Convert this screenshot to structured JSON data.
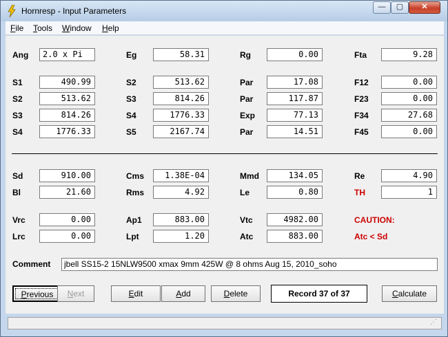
{
  "window": {
    "title": "Hornresp - Input Parameters",
    "controls": {
      "minimize": "—",
      "maximize": "▢",
      "close": "✕"
    },
    "accent_color": "#e8c400"
  },
  "menu": [
    {
      "label": "File",
      "accel": "F"
    },
    {
      "label": "Tools",
      "accel": "T"
    },
    {
      "label": "Window",
      "accel": "W"
    },
    {
      "label": "Help",
      "accel": "H"
    }
  ],
  "params": {
    "Ang": {
      "label": "Ang",
      "value": "2.0 x Pi"
    },
    "Eg": {
      "label": "Eg",
      "value": "58.31"
    },
    "Rg": {
      "label": "Rg",
      "value": "0.00"
    },
    "Fta": {
      "label": "Fta",
      "value": "9.28"
    },
    "S1": {
      "label": "S1",
      "value": "490.99"
    },
    "S2a": {
      "label": "S2",
      "value": "513.62"
    },
    "Par1": {
      "label": "Par",
      "value": "17.08"
    },
    "F12": {
      "label": "F12",
      "value": "0.00"
    },
    "S2b": {
      "label": "S2",
      "value": "513.62"
    },
    "S3a": {
      "label": "S3",
      "value": "814.26"
    },
    "Par2": {
      "label": "Par",
      "value": "117.87"
    },
    "F23": {
      "label": "F23",
      "value": "0.00"
    },
    "S3b": {
      "label": "S3",
      "value": "814.26"
    },
    "S4a": {
      "label": "S4",
      "value": "1776.33"
    },
    "Exp": {
      "label": "Exp",
      "value": "77.13"
    },
    "F34": {
      "label": "F34",
      "value": "27.68"
    },
    "S4b": {
      "label": "S4",
      "value": "1776.33"
    },
    "S5": {
      "label": "S5",
      "value": "2167.74"
    },
    "Par3": {
      "label": "Par",
      "value": "14.51"
    },
    "F45": {
      "label": "F45",
      "value": "0.00"
    },
    "Sd": {
      "label": "Sd",
      "value": "910.00"
    },
    "Cms": {
      "label": "Cms",
      "value": "1.38E-04"
    },
    "Mmd": {
      "label": "Mmd",
      "value": "134.05"
    },
    "Re": {
      "label": "Re",
      "value": "4.90"
    },
    "Bl": {
      "label": "Bl",
      "value": "21.60"
    },
    "Rms": {
      "label": "Rms",
      "value": "4.92"
    },
    "Le": {
      "label": "Le",
      "value": "0.80"
    },
    "TH": {
      "label": "TH",
      "value": "1"
    },
    "Vrc": {
      "label": "Vrc",
      "value": "0.00"
    },
    "Ap1": {
      "label": "Ap1",
      "value": "883.00"
    },
    "Vtc": {
      "label": "Vtc",
      "value": "4982.00"
    },
    "Lrc": {
      "label": "Lrc",
      "value": "0.00"
    },
    "Lpt": {
      "label": "Lpt",
      "value": "1.20"
    },
    "Atc": {
      "label": "Atc",
      "value": "883.00"
    }
  },
  "caution": {
    "title": "CAUTION:",
    "message": "Atc < Sd",
    "color": "#cc0000"
  },
  "comment": {
    "label": "Comment",
    "value": "jbell SS15-2 15NLW9500 xmax 9mm 425W @ 8 ohms Aug 15, 2010_soho"
  },
  "buttons": {
    "previous": "Previous",
    "next": "Next",
    "edit": "Edit",
    "add": "Add",
    "delete": "Delete",
    "calculate": "Calculate"
  },
  "record": "Record 37 of 37",
  "status": ""
}
